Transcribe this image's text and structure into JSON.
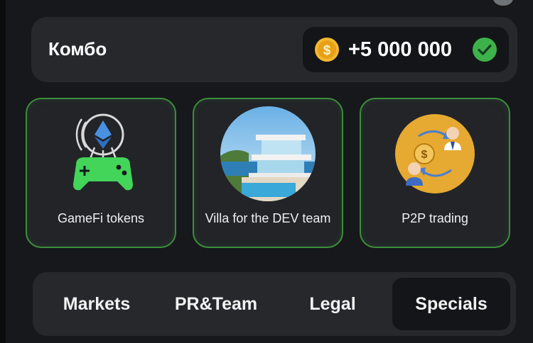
{
  "combo": {
    "label": "Комбо",
    "reward": "+5 000 000",
    "coin_icon": "coin-icon",
    "status_icon": "check-icon"
  },
  "cards": [
    {
      "label": "GameFi tokens",
      "icon": "gamefi-icon"
    },
    {
      "label": "Villa for the DEV team",
      "icon": "villa-image"
    },
    {
      "label": "P2P trading",
      "icon": "p2p-trading-icon"
    }
  ],
  "tabs": [
    {
      "label": "Markets",
      "active": false
    },
    {
      "label": "PR&Team",
      "active": false
    },
    {
      "label": "Legal",
      "active": false
    },
    {
      "label": "Specials",
      "active": true
    }
  ],
  "colors": {
    "accent_green": "#3c8f3a",
    "coin_gold": "#f5b82e",
    "check_green": "#3db24a"
  }
}
